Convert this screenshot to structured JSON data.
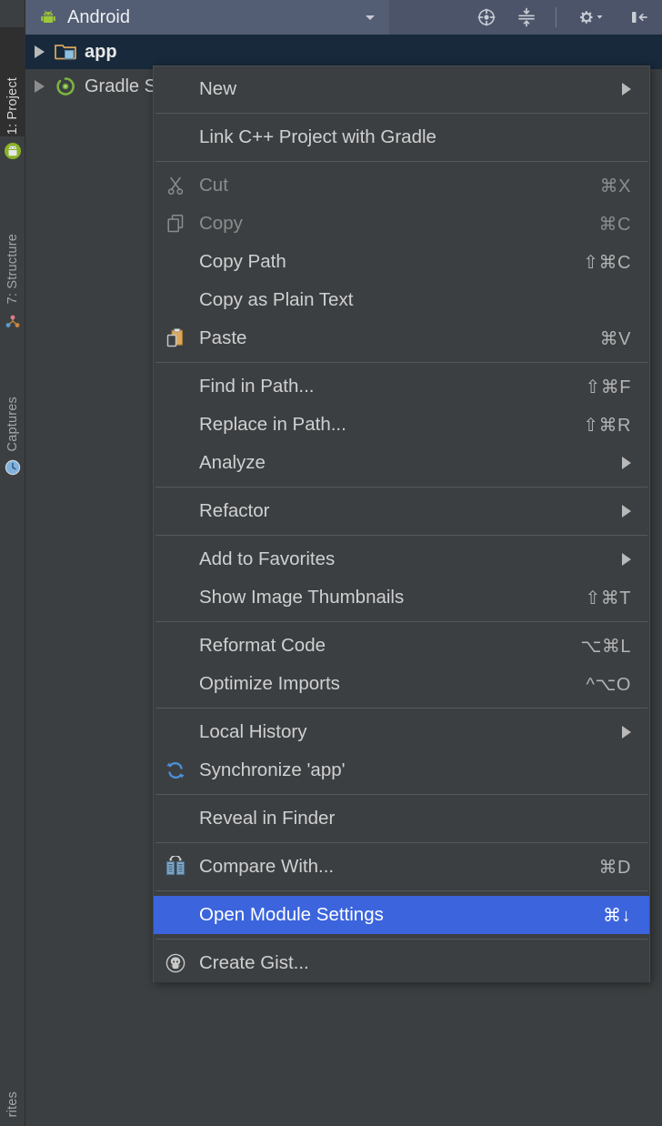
{
  "window": {
    "background_color": "#3c3f41",
    "header_color": "#4b5468",
    "selection_color": "#3b64dd",
    "tree_selection_color": "#17293b"
  },
  "sidebar": {
    "tabs": [
      {
        "label": "1: Project",
        "icon": "android-icon",
        "active": true
      },
      {
        "label": "7: Structure",
        "icon": "structure-icon",
        "active": false
      },
      {
        "label": "Captures",
        "icon": "captures-icon",
        "active": false
      },
      {
        "label": "rites",
        "icon": "none",
        "active": false
      }
    ]
  },
  "header": {
    "view_title": "Android",
    "view_icon": "android-icon",
    "dropdown_icon": "chevron-down-icon",
    "tools": [
      {
        "name": "select-opened-file-icon",
        "label": "Select Opened File"
      },
      {
        "name": "collapse-all-icon",
        "label": "Collapse All"
      },
      {
        "name": "settings-gear-icon",
        "label": "Settings"
      },
      {
        "name": "hide-panel-icon",
        "label": "Hide"
      }
    ]
  },
  "tree": {
    "rows": [
      {
        "label": "app",
        "icon": "module-folder-icon",
        "expander": "collapsed",
        "selected": true,
        "bold": true
      },
      {
        "label": "Gradle S",
        "icon": "gradle-icon",
        "expander": "collapsed",
        "selected": false,
        "bold": false
      }
    ]
  },
  "context_menu": {
    "groups": [
      {
        "items": [
          {
            "label": "New",
            "shortcut": "",
            "icon": "none",
            "submenu": true,
            "disabled": false,
            "selected": false
          }
        ]
      },
      {
        "items": [
          {
            "label": "Link C++ Project with Gradle",
            "shortcut": "",
            "icon": "none",
            "submenu": false,
            "disabled": false,
            "selected": false
          }
        ]
      },
      {
        "items": [
          {
            "label": "Cut",
            "shortcut": "⌘X",
            "icon": "scissors-icon",
            "submenu": false,
            "disabled": true,
            "selected": false
          },
          {
            "label": "Copy",
            "shortcut": "⌘C",
            "icon": "copy-icon",
            "submenu": false,
            "disabled": true,
            "selected": false
          },
          {
            "label": "Copy Path",
            "shortcut": "⇧⌘C",
            "icon": "none",
            "submenu": false,
            "disabled": false,
            "selected": false
          },
          {
            "label": "Copy as Plain Text",
            "shortcut": "",
            "icon": "none",
            "submenu": false,
            "disabled": false,
            "selected": false
          },
          {
            "label": "Paste",
            "shortcut": "⌘V",
            "icon": "paste-icon",
            "submenu": false,
            "disabled": false,
            "selected": false
          }
        ]
      },
      {
        "items": [
          {
            "label": "Find in Path...",
            "shortcut": "⇧⌘F",
            "icon": "none",
            "submenu": false,
            "disabled": false,
            "selected": false
          },
          {
            "label": "Replace in Path...",
            "shortcut": "⇧⌘R",
            "icon": "none",
            "submenu": false,
            "disabled": false,
            "selected": false
          },
          {
            "label": "Analyze",
            "shortcut": "",
            "icon": "none",
            "submenu": true,
            "disabled": false,
            "selected": false
          }
        ]
      },
      {
        "items": [
          {
            "label": "Refactor",
            "shortcut": "",
            "icon": "none",
            "submenu": true,
            "disabled": false,
            "selected": false
          }
        ]
      },
      {
        "items": [
          {
            "label": "Add to Favorites",
            "shortcut": "",
            "icon": "none",
            "submenu": true,
            "disabled": false,
            "selected": false
          },
          {
            "label": "Show Image Thumbnails",
            "shortcut": "⇧⌘T",
            "icon": "none",
            "submenu": false,
            "disabled": false,
            "selected": false
          }
        ]
      },
      {
        "items": [
          {
            "label": "Reformat Code",
            "shortcut": "⌥⌘L",
            "icon": "none",
            "submenu": false,
            "disabled": false,
            "selected": false
          },
          {
            "label": "Optimize Imports",
            "shortcut": "^⌥O",
            "icon": "none",
            "submenu": false,
            "disabled": false,
            "selected": false
          }
        ]
      },
      {
        "items": [
          {
            "label": "Local History",
            "shortcut": "",
            "icon": "none",
            "submenu": true,
            "disabled": false,
            "selected": false
          },
          {
            "label": "Synchronize 'app'",
            "shortcut": "",
            "icon": "synchronize-icon",
            "submenu": false,
            "disabled": false,
            "selected": false
          }
        ]
      },
      {
        "items": [
          {
            "label": "Reveal in Finder",
            "shortcut": "",
            "icon": "none",
            "submenu": false,
            "disabled": false,
            "selected": false
          }
        ]
      },
      {
        "items": [
          {
            "label": "Compare With...",
            "shortcut": "⌘D",
            "icon": "compare-icon",
            "submenu": false,
            "disabled": false,
            "selected": false
          }
        ]
      },
      {
        "items": [
          {
            "label": "Open Module Settings",
            "shortcut": "⌘↓",
            "icon": "none",
            "submenu": false,
            "disabled": false,
            "selected": true
          }
        ]
      },
      {
        "items": [
          {
            "label": "Create Gist...",
            "shortcut": "",
            "icon": "github-icon",
            "submenu": false,
            "disabled": false,
            "selected": false
          }
        ]
      }
    ]
  }
}
